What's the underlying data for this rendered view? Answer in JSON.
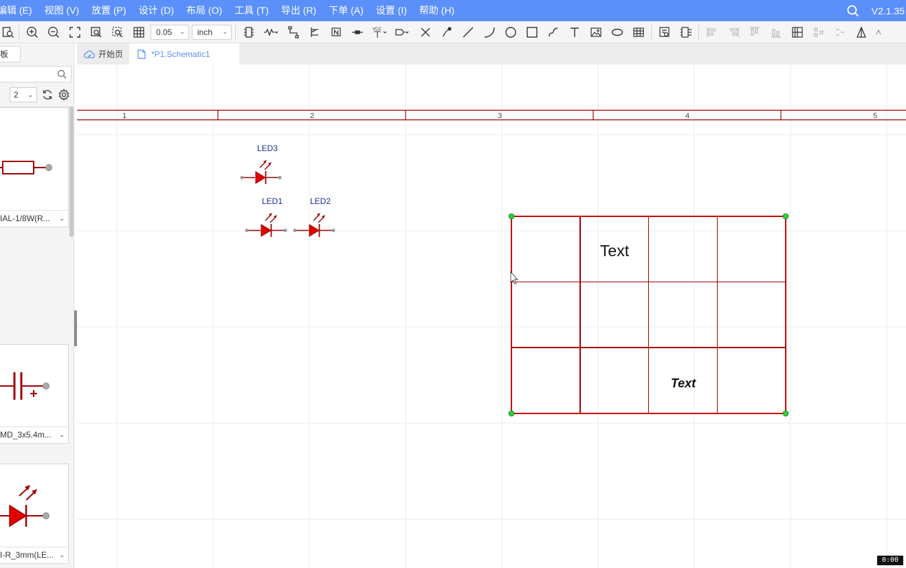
{
  "menubar": {
    "items": [
      "编辑 (E)",
      "视图 (V)",
      "放置 (P)",
      "设计 (D)",
      "布局 (O)",
      "工具 (T)",
      "导出 (R)",
      "下单 (A)",
      "设置 (I)",
      "帮助 (H)"
    ],
    "version": "V2.1.35"
  },
  "toolbar": {
    "grid_size": "0.05",
    "unit": "inch"
  },
  "sidebar": {
    "tab_label": "板",
    "page_number": "2",
    "cards": [
      {
        "label": "IAL-1/8W(R...",
        "symbol": "resistor"
      },
      {
        "label": "MD_3x5.4m...",
        "symbol": "polarized-capacitor"
      },
      {
        "label": "I-R_3mm(LE...",
        "symbol": "led"
      }
    ]
  },
  "tabs": [
    {
      "label": "开始页",
      "icon": "cloud-icon"
    },
    {
      "label": "*P1.Schematic1",
      "icon": "file-icon"
    }
  ],
  "canvas": {
    "border_zones": [
      "1",
      "2",
      "3",
      "4",
      "5"
    ],
    "components": [
      {
        "designator": "LED3"
      },
      {
        "designator": "LED1"
      },
      {
        "designator": "LED2"
      }
    ],
    "table": {
      "rows": 3,
      "cols": 4,
      "cell_text_1": "Text",
      "cell_text_2": "Text"
    }
  },
  "timer": "0:00",
  "colors": {
    "accent": "#5b8ff9",
    "schematic_red": "#c00000",
    "led_red": "#e00000",
    "designator_blue": "#1a2b8c",
    "handle_green": "#2ecc40"
  }
}
